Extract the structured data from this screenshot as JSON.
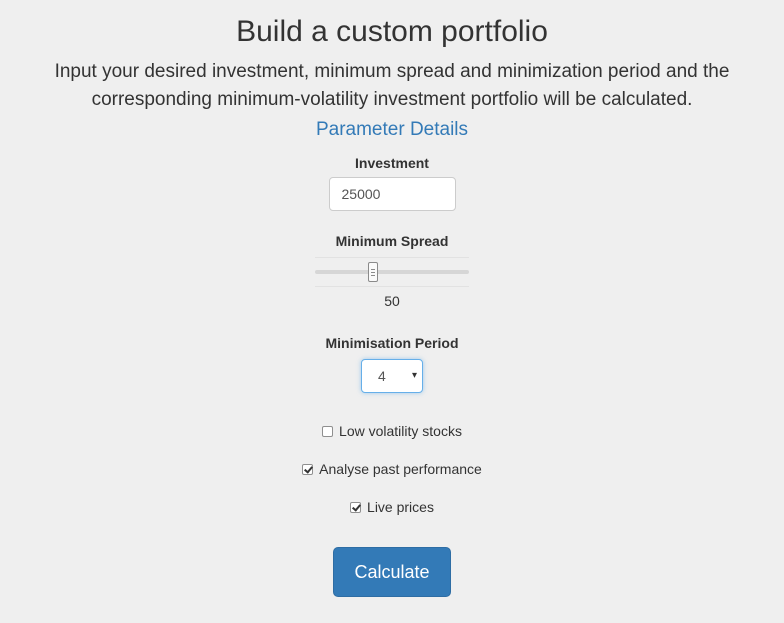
{
  "header": {
    "title": "Build a custom portfolio",
    "description": "Input your desired investment, minimum spread and minimization period and the corresponding minimum-volatility investment portfolio will be calculated.",
    "details_link": "Parameter Details"
  },
  "investment": {
    "label": "Investment",
    "value": "25000"
  },
  "spread": {
    "label": "Minimum Spread",
    "value": "50",
    "position_fraction": 0.37
  },
  "period": {
    "label": "Minimisation Period",
    "selected": "4",
    "arrow": "▾"
  },
  "options": [
    {
      "label": "Low volatility stocks",
      "checked": false
    },
    {
      "label": "Analyse past performance",
      "checked": true
    },
    {
      "label": "Live prices",
      "checked": true
    }
  ],
  "actions": {
    "calculate_label": "Calculate"
  },
  "colors": {
    "background": "#efefef",
    "link": "#337ab7",
    "primary_button": "#337ab7",
    "select_focus_border": "#66afe9"
  }
}
